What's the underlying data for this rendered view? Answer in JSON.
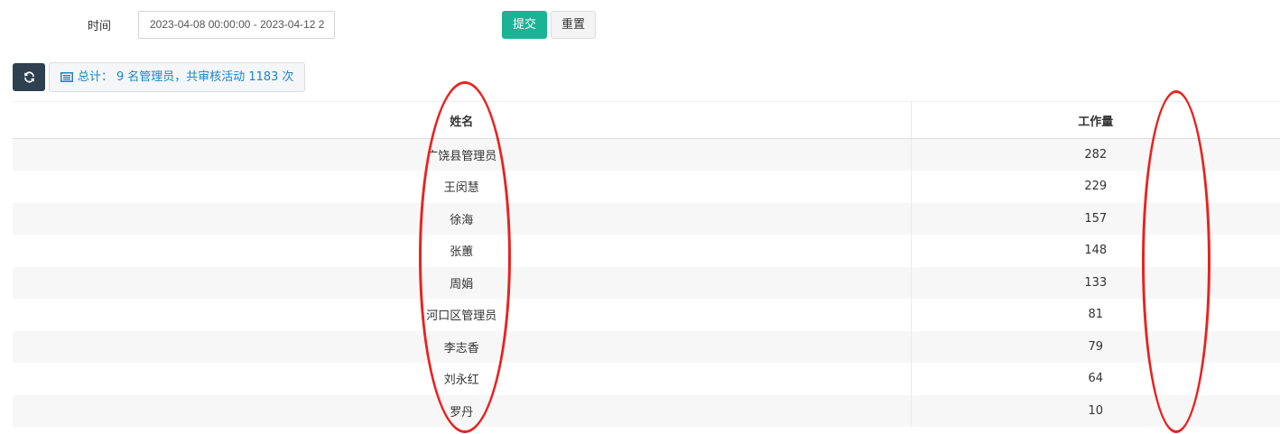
{
  "filter": {
    "time_label": "时间",
    "time_range_value": "2023-04-08 00:00:00 - 2023-04-12 2",
    "submit_label": "提交",
    "reset_label": "重置"
  },
  "toolbar": {
    "refresh_icon": "refresh-icon",
    "summary_icon": "list-alt-icon",
    "summary_prefix": "总计：",
    "summary_admin_count": "9",
    "summary_middle": "名管理员，共审核活动",
    "summary_activity_count": "1183",
    "summary_suffix": "次"
  },
  "table": {
    "columns": [
      "姓名",
      "工作量"
    ],
    "rows": [
      {
        "name": "广饶县管理员",
        "workload": "282"
      },
      {
        "name": "王闵慧",
        "workload": "229"
      },
      {
        "name": "徐海",
        "workload": "157"
      },
      {
        "name": "张蕙",
        "workload": "148"
      },
      {
        "name": "周娟",
        "workload": "133"
      },
      {
        "name": "河口区管理员",
        "workload": "81"
      },
      {
        "name": "李志香",
        "workload": "79"
      },
      {
        "name": "刘永红",
        "workload": "64"
      },
      {
        "name": "罗丹",
        "workload": "10"
      }
    ]
  },
  "colors": {
    "submit_green": "#1ab394",
    "refresh_dark": "#2f4050",
    "summary_blue": "#1c84c6",
    "annotation_red": "#e8231f"
  }
}
